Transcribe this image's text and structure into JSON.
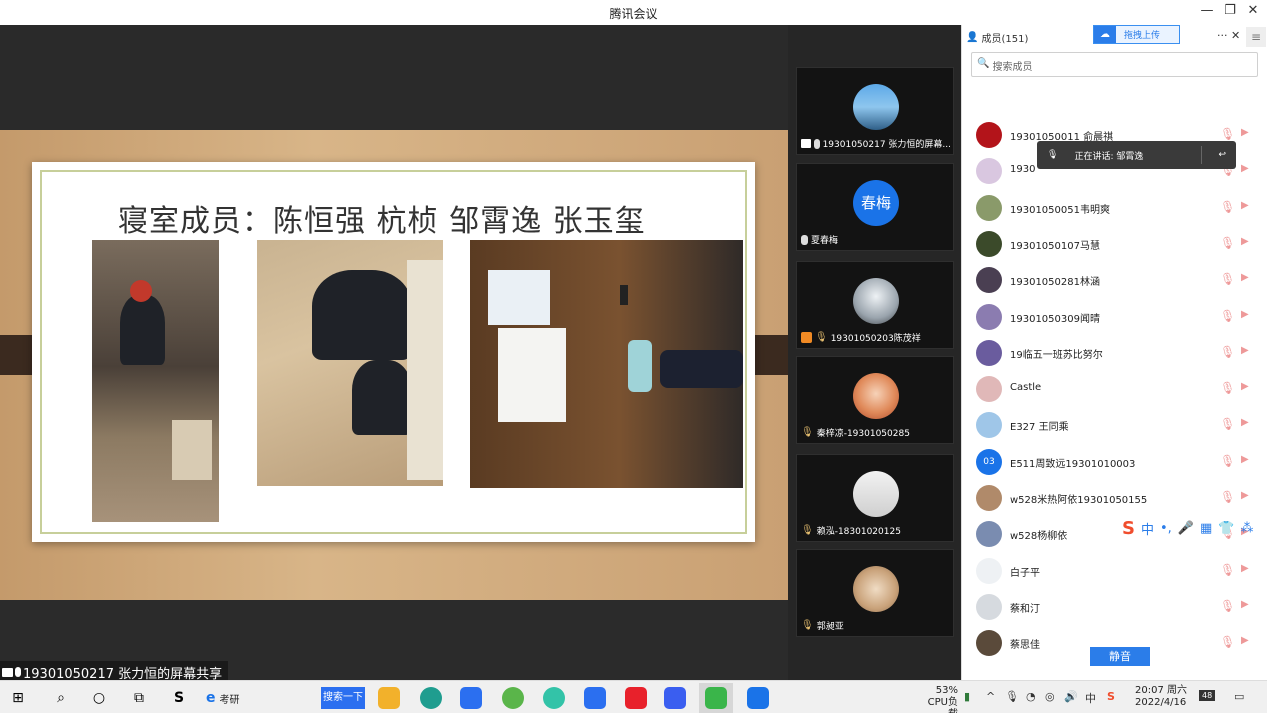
{
  "window": {
    "title": "腾讯会议",
    "controls": [
      "—",
      "❐",
      "✕"
    ]
  },
  "share": {
    "slide_title": "寝室成员：陈恒强 杭桢 邹霄逸 张玉玺",
    "caption": "19301050217 张力恒的屏幕共享"
  },
  "video_tiles": [
    {
      "label": "19301050217 张力恒的屏幕...",
      "avatar_color": "#3b86c6",
      "avatar_text": ""
    },
    {
      "label": "夏春梅",
      "avatar_color": "#1a73e8",
      "avatar_text": "春梅"
    },
    {
      "label": "19301050203陈茂祥",
      "avatar_color": "#c0c4c8",
      "avatar_text": ""
    },
    {
      "label": "秦梓凉-19301050285",
      "avatar_color": "#d98c5f",
      "avatar_text": ""
    },
    {
      "label": "赖泓-18301020125",
      "avatar_color": "#d9d9d9",
      "avatar_text": ""
    },
    {
      "label": "郭昶亚",
      "avatar_color": "#c9a27a",
      "avatar_text": ""
    }
  ],
  "panel": {
    "members_title": "成员(151)",
    "upload_label": "拖拽上传",
    "more": "···",
    "close": "✕",
    "search_placeholder": "搜索成员",
    "speaking_label": "正在讲话: 邹霄逸",
    "mute_all": "静音",
    "members": [
      {
        "name": "19301050011 俞晨祺",
        "color": "#b3141a"
      },
      {
        "name": "1930",
        "color": "#d9c7e0"
      },
      {
        "name": "19301050051韦明爽",
        "color": "#8a9a6a"
      },
      {
        "name": "19301050107马慧",
        "color": "#3b4a2a"
      },
      {
        "name": "19301050281林涵",
        "color": "#4a3f52"
      },
      {
        "name": "19301050309闻晴",
        "color": "#8b7cb0"
      },
      {
        "name": "19临五一班苏比努尔",
        "color": "#6a5c9e"
      },
      {
        "name": "Castle",
        "color": "#e0b8b8"
      },
      {
        "name": "E327 王同乘",
        "color": "#9fc6e8"
      },
      {
        "name": "E511周致远19301010003",
        "color": "#1a73e8",
        "initial": "03"
      },
      {
        "name": "w528米热阿依19301050155",
        "color": "#b08a6a"
      },
      {
        "name": "w528杨柳依",
        "color": "#7a8cb0"
      },
      {
        "name": "白子平",
        "color": "#eef1f4"
      },
      {
        "name": "蔡和汀",
        "color": "#d6dadf"
      },
      {
        "name": "蔡思佳",
        "color": "#5a4a3a"
      }
    ]
  },
  "ime": {
    "items": [
      "中",
      "•,",
      "🎤",
      "▦",
      "👕",
      "⁂"
    ]
  },
  "taskbar": {
    "search_text": "考研",
    "search_button": "搜索一下",
    "cpu_percent": "53%",
    "cpu_label": "CPU负载",
    "time": "20:07 周六",
    "date": "2022/4/16",
    "notification_badge": "48"
  }
}
